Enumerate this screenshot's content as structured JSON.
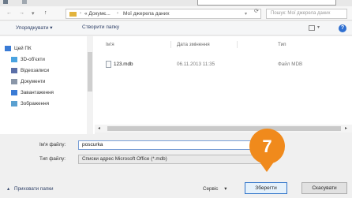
{
  "top": {
    "search_placeholder": "Пошук: Мої джерела даних"
  },
  "address": {
    "back": "←",
    "forward": "→",
    "up": "↑",
    "down_chev": "▾",
    "crumbs": [
      "« Докумє...",
      "Мої джерела даних"
    ],
    "separator": "›",
    "dropdown": "▾",
    "refresh": "⟳"
  },
  "toolbar": {
    "organize": "Упорядкувати ▾",
    "new_folder": "Створити папку",
    "view_chev": "▾",
    "help": "?"
  },
  "nav": {
    "items": [
      {
        "label": "Цей ПК",
        "icon": "computer-icon",
        "color": "#3a7bd5"
      },
      {
        "label": "3D-об'єкти",
        "icon": "cube-icon",
        "color": "#4aa3e0"
      },
      {
        "label": "Відеозаписи",
        "icon": "video-icon",
        "color": "#5a6fa8"
      },
      {
        "label": "Документи",
        "icon": "document-icon",
        "color": "#8a96a8"
      },
      {
        "label": "Завантаження",
        "icon": "download-icon",
        "color": "#3a7bd5"
      },
      {
        "label": "Зображення",
        "icon": "picture-icon",
        "color": "#5aa0d0"
      }
    ]
  },
  "files": {
    "columns": [
      "Ім'я",
      "Дата змінення",
      "Тип"
    ],
    "rows": [
      {
        "name": "123.mdb",
        "date": "06.11.2013 11:35",
        "type": "Файл MDB"
      }
    ]
  },
  "scroll": {
    "left": "◂",
    "right": "▸"
  },
  "form": {
    "filename_label": "Ім'я файлу:",
    "filename_value": "poscurka",
    "filetype_label": "Тип файлу:",
    "filetype_value": "Списки адрес Microsoft Office (*.mdb)"
  },
  "callout": {
    "number": "7",
    "color": "#f08a1c"
  },
  "footer": {
    "hide_folders": "Приховати папки",
    "chev": "▴",
    "tools": "Сервіс",
    "tools_chev": "▾",
    "save": "Зберегти",
    "cancel": "Скасувати"
  }
}
